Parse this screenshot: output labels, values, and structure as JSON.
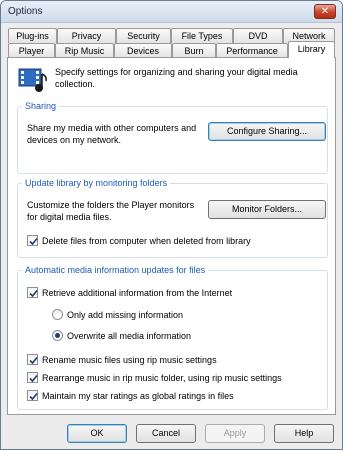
{
  "window": {
    "title": "Options"
  },
  "tabs_row1": [
    "Plug-ins",
    "Privacy",
    "Security",
    "File Types",
    "DVD",
    "Network"
  ],
  "tabs_row2": [
    "Player",
    "Rip Music",
    "Devices",
    "Burn",
    "Performance",
    "Library"
  ],
  "active_tab": "Library",
  "header": {
    "description": "Specify settings for organizing and sharing your digital media collection."
  },
  "sharing": {
    "legend": "Sharing",
    "text": "Share my media with other computers and devices on my network.",
    "button": "Configure Sharing..."
  },
  "monitoring": {
    "legend": "Update library by monitoring folders",
    "text": "Customize the folders the Player monitors for digital media files.",
    "button": "Monitor Folders...",
    "delete_files": {
      "label": "Delete files from computer when deleted from library",
      "checked": true
    }
  },
  "auto_updates": {
    "legend": "Automatic media information updates for files",
    "retrieve": {
      "label": "Retrieve additional information from the Internet",
      "checked": true
    },
    "only_missing": {
      "label": "Only add missing information",
      "selected": false
    },
    "overwrite": {
      "label": "Overwrite all media information",
      "selected": true
    },
    "rename": {
      "label": "Rename music files using rip music settings",
      "checked": true
    },
    "rearrange": {
      "label": "Rearrange music in rip music folder, using rip music settings",
      "checked": true
    },
    "star_ratings": {
      "label": "Maintain my star ratings as global ratings in files",
      "checked": true
    }
  },
  "footer": {
    "ok": "OK",
    "cancel": "Cancel",
    "apply": "Apply",
    "help": "Help"
  },
  "colors": {
    "legend": "#1e5bb8",
    "close": "#c8452c"
  }
}
